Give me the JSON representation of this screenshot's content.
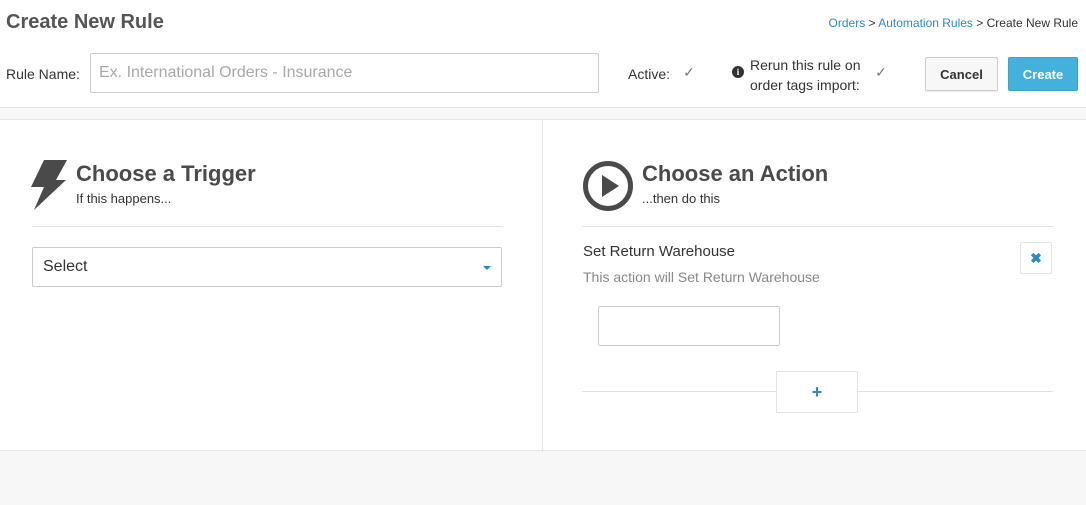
{
  "header": {
    "title": "Create New Rule",
    "breadcrumb": {
      "orders": "Orders",
      "sep1": " > ",
      "automation_rules": "Automation Rules",
      "sep2": " > ",
      "current": "Create New Rule"
    }
  },
  "form": {
    "rule_name_label": "Rule Name:",
    "rule_name_value": "",
    "rule_name_placeholder": "Ex. International Orders - Insurance",
    "active_label": "Active:",
    "active_checked": true,
    "rerun_label": "Rerun this rule on order tags import:",
    "rerun_checked": true,
    "cancel_label": "Cancel",
    "create_label": "Create"
  },
  "trigger": {
    "title": "Choose a Trigger",
    "subtitle": "If this happens...",
    "select_value": "Select",
    "icon": "lightning-bolt-icon"
  },
  "action": {
    "title": "Choose an Action",
    "subtitle": "...then do this",
    "icon": "play-circle-icon",
    "items": [
      {
        "name": "Set Return Warehouse",
        "description": "This action will Set Return Warehouse",
        "value": ""
      }
    ]
  },
  "colors": {
    "accent": "#2a8bc4",
    "primary_button": "#43b1db",
    "title_text": "#4a4a4a"
  }
}
